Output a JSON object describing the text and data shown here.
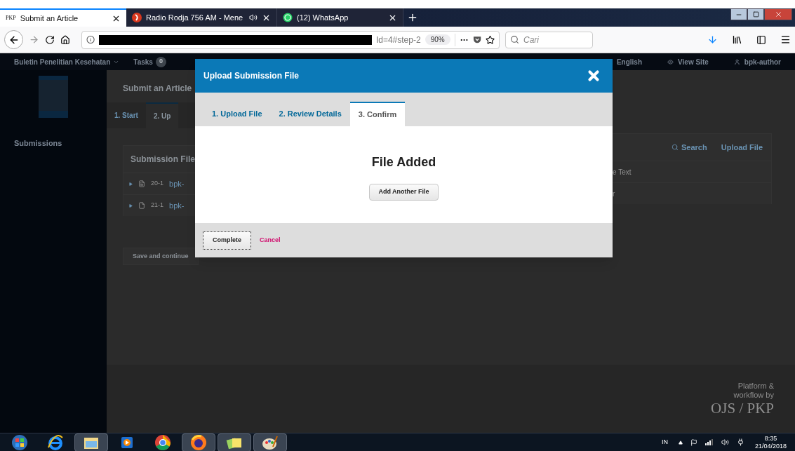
{
  "browser": {
    "tabs": [
      {
        "kind": "pkp",
        "favicon": "PKP",
        "title": "Submit an Article",
        "selected": true,
        "audio": false
      },
      {
        "kind": "radio",
        "title": "Radio Rodja 756 AM - Mene",
        "selected": false,
        "audio": true
      },
      {
        "kind": "chat",
        "title": "(12) WhatsApp",
        "selected": false,
        "audio": false
      }
    ],
    "address": {
      "visible_text": "Id=4#step-2",
      "zoom": "90%"
    },
    "search": {
      "placeholder": "Cari"
    }
  },
  "top_nav": {
    "journal": "Buletin Penelitian Kesehatan",
    "tasks": "Tasks",
    "tasks_count": "0",
    "links": [
      {
        "kind": "language",
        "label": "English"
      },
      {
        "kind": "view",
        "label": "View Site"
      },
      {
        "kind": "user",
        "label": "bpk-author"
      }
    ]
  },
  "sidebar": {
    "items": [
      {
        "label": "Submissions"
      }
    ]
  },
  "main": {
    "title": "Submit an Article",
    "steps": [
      {
        "label": "1. Start",
        "selected": false
      },
      {
        "label": "2. Up",
        "selected": true
      }
    ],
    "files": {
      "title": "Submission File",
      "actions": [
        {
          "kind": "search",
          "label": "Search"
        },
        {
          "kind": "upload",
          "label": "Upload File"
        }
      ],
      "rows": [
        {
          "kind": "doc",
          "id": "20-1",
          "name": "bpk-",
          "column_3": "e Text"
        },
        {
          "kind": "pdf",
          "id": "21-1",
          "name": "bpk-",
          "column_3": "r"
        }
      ]
    },
    "save": "Save and continue"
  },
  "modal": {
    "title": "Upload Submission File",
    "tabs": [
      {
        "label": "1. Upload File",
        "selected": false
      },
      {
        "label": "2. Review Details",
        "selected": false
      },
      {
        "label": "3. Confirm",
        "selected": true
      }
    ],
    "heading": "File Added",
    "add_button": "Add Another File",
    "complete": "Complete",
    "cancel": "Cancel"
  },
  "footer": {
    "lines": [
      "Platform &",
      "workflow by"
    ],
    "logo": "OJS / PKP"
  },
  "taskbar": {
    "apps": [
      {
        "kind": "start",
        "running": false
      },
      {
        "kind": "ie",
        "running": false
      },
      {
        "kind": "folder",
        "running": true
      },
      {
        "kind": "player",
        "running": false
      },
      {
        "kind": "chrome",
        "running": false
      },
      {
        "kind": "firefox",
        "running": true
      },
      {
        "kind": "notes",
        "running": true
      },
      {
        "kind": "paint",
        "running": true
      }
    ],
    "language": "IN",
    "time": "8:35",
    "date": "21/04/2018"
  }
}
